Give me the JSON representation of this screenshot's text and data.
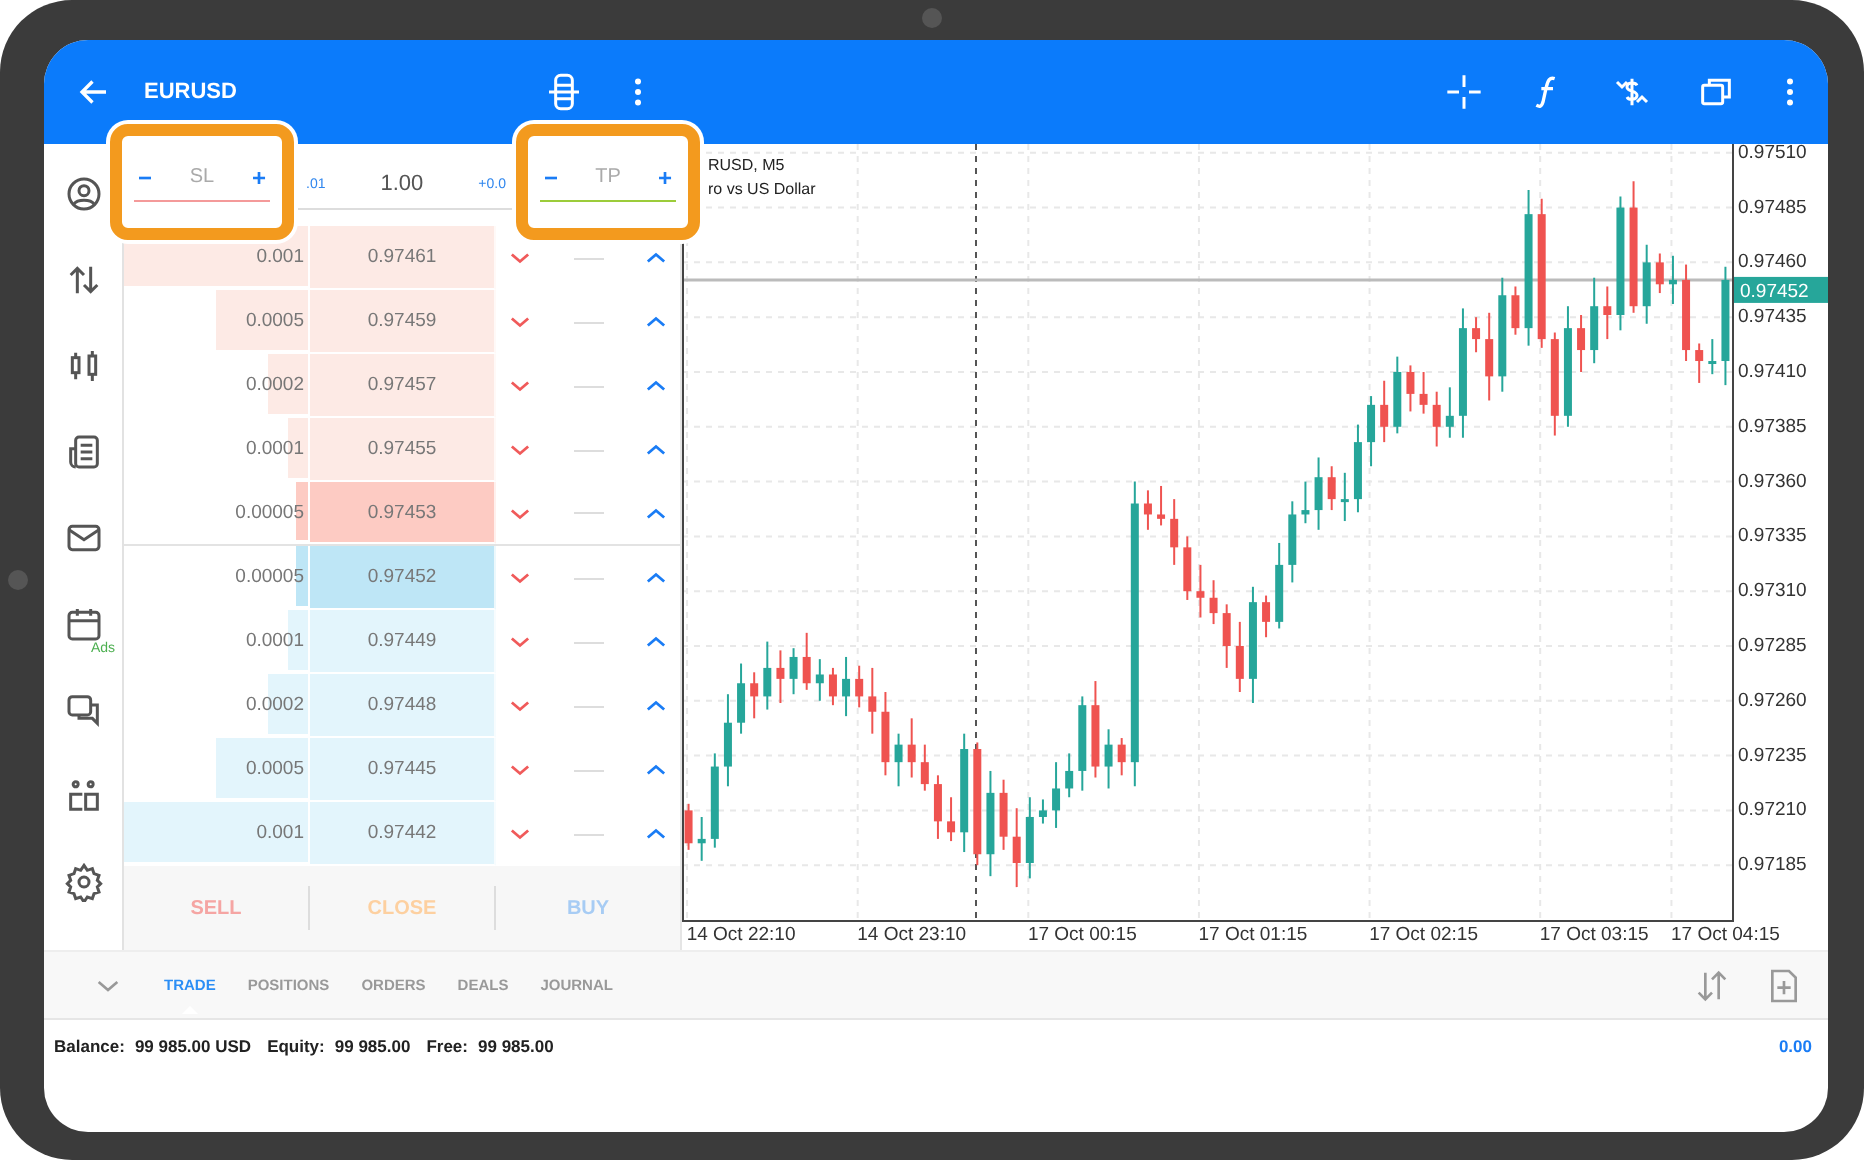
{
  "top_bar": {
    "title": "EURUSD"
  },
  "side_nav": {
    "ads_badge": "Ads"
  },
  "order_panel": {
    "sl_field": {
      "minus": "−",
      "label": "SL",
      "plus": "+",
      "kind": "sl",
      "highlighted": true
    },
    "volume": {
      "step_down": ".01",
      "value": "1.00",
      "step_up": "+0.0"
    },
    "tp_field": {
      "minus": "−",
      "label": "TP",
      "plus": "+",
      "kind": "tp",
      "highlighted": true
    },
    "depth_rows": [
      {
        "volume": "0.001",
        "price": "0.97461",
        "kind": "sell",
        "best": false,
        "level": 1
      },
      {
        "volume": "0.0005",
        "price": "0.97459",
        "kind": "sell",
        "best": false,
        "level": 0.5
      },
      {
        "volume": "0.0002",
        "price": "0.97457",
        "kind": "sell",
        "best": false,
        "level": 0.22
      },
      {
        "volume": "0.0001",
        "price": "0.97455",
        "kind": "sell",
        "best": false,
        "level": 0.11
      },
      {
        "volume": "0.00005",
        "price": "0.97453",
        "kind": "sell",
        "best": true,
        "level": 0.06
      },
      {
        "volume": "0.00005",
        "price": "0.97452",
        "kind": "buy",
        "best": true,
        "level": 0.06
      },
      {
        "volume": "0.0001",
        "price": "0.97449",
        "kind": "buy",
        "best": false,
        "level": 0.11
      },
      {
        "volume": "0.0002",
        "price": "0.97448",
        "kind": "buy",
        "best": false,
        "level": 0.22
      },
      {
        "volume": "0.0005",
        "price": "0.97445",
        "kind": "buy",
        "best": false,
        "level": 0.5
      },
      {
        "volume": "0.001",
        "price": "0.97442",
        "kind": "buy",
        "best": false,
        "level": 1
      }
    ],
    "buttons": [
      {
        "label": "SELL",
        "kind": "sell",
        "disabled": true
      },
      {
        "label": "CLOSE",
        "kind": "close",
        "disabled": true
      },
      {
        "label": "BUY",
        "kind": "buy",
        "disabled": true
      }
    ]
  },
  "chart": {
    "symbol": "RUSD, M5",
    "description": "ro vs US Dollar",
    "chart_data": {
      "type": "candlestick",
      "categories": [
        null,
        null,
        null,
        null,
        "14 Oct 22:10",
        null,
        null,
        null,
        null,
        null,
        null,
        null,
        null,
        null,
        null,
        null,
        null,
        "14 Oct 23:10",
        null,
        null,
        null,
        null,
        null,
        null,
        null,
        null,
        null,
        null,
        null,
        null,
        "17 Oct 00:15",
        null,
        null,
        null,
        null,
        null,
        null,
        null,
        null,
        null,
        null,
        null,
        null,
        "17 Oct 01:15",
        null,
        null,
        null,
        null,
        null,
        null,
        null,
        null,
        null,
        null,
        null,
        null,
        "17 Oct 02:15",
        null,
        null,
        null,
        null,
        null,
        null,
        null,
        null,
        null,
        null,
        null,
        null,
        "17 Oct 03:15",
        null,
        null,
        null,
        null,
        null,
        null,
        null,
        null,
        null,
        "17 Oct 04:15"
      ],
      "grid": true,
      "ref_lines": [
        {
          "axis": "y",
          "value": 0.97452,
          "label": "0.97452"
        }
      ],
      "ohlc": [
        [
          0.9721,
          0.97213,
          0.97192,
          0.97195
        ],
        [
          0.97195,
          0.97207,
          0.97187,
          0.97197
        ],
        [
          0.97197,
          0.97236,
          0.97193,
          0.9723
        ],
        [
          0.9723,
          0.97263,
          0.97221,
          0.9725
        ],
        [
          0.9725,
          0.97277,
          0.97245,
          0.97268
        ],
        [
          0.97268,
          0.97273,
          0.97252,
          0.97262
        ],
        [
          0.97262,
          0.97287,
          0.97256,
          0.97275
        ],
        [
          0.97275,
          0.97283,
          0.97259,
          0.9727
        ],
        [
          0.9727,
          0.97284,
          0.97263,
          0.9728
        ],
        [
          0.9728,
          0.97291,
          0.97265,
          0.97268
        ],
        [
          0.97268,
          0.97279,
          0.9726,
          0.97272
        ],
        [
          0.97272,
          0.97275,
          0.97258,
          0.97262
        ],
        [
          0.97262,
          0.9728,
          0.97253,
          0.9727
        ],
        [
          0.9727,
          0.97276,
          0.97257,
          0.97262
        ],
        [
          0.97262,
          0.97275,
          0.97245,
          0.97255
        ],
        [
          0.97255,
          0.97264,
          0.97226,
          0.97232
        ],
        [
          0.97232,
          0.97245,
          0.97221,
          0.9724
        ],
        [
          0.9724,
          0.97252,
          0.97225,
          0.97232
        ],
        [
          0.97232,
          0.9724,
          0.97219,
          0.97222
        ],
        [
          0.97222,
          0.97226,
          0.97197,
          0.97205
        ],
        [
          0.97205,
          0.97216,
          0.97196,
          0.972
        ],
        [
          0.972,
          0.97245,
          0.97191,
          0.97238
        ],
        [
          0.97238,
          0.97241,
          0.97185,
          0.9719
        ],
        [
          0.9719,
          0.97228,
          0.9718,
          0.97218
        ],
        [
          0.97218,
          0.97224,
          0.97192,
          0.97198
        ],
        [
          0.97198,
          0.97211,
          0.97175,
          0.97186
        ],
        [
          0.97186,
          0.97216,
          0.97179,
          0.97207
        ],
        [
          0.97207,
          0.97215,
          0.97204,
          0.9721
        ],
        [
          0.9721,
          0.97232,
          0.97202,
          0.9722
        ],
        [
          0.9722,
          0.97236,
          0.97216,
          0.97228
        ],
        [
          0.97228,
          0.97262,
          0.97219,
          0.97258
        ],
        [
          0.97258,
          0.97269,
          0.97225,
          0.9723
        ],
        [
          0.9723,
          0.97247,
          0.9722,
          0.9724
        ],
        [
          0.9724,
          0.97243,
          0.97226,
          0.97232
        ],
        [
          0.97232,
          0.9736,
          0.97221,
          0.9735
        ],
        [
          0.9735,
          0.97356,
          0.97338,
          0.97345
        ],
        [
          0.97345,
          0.97358,
          0.9734,
          0.97343
        ],
        [
          0.97343,
          0.97352,
          0.97322,
          0.9733
        ],
        [
          0.9733,
          0.97335,
          0.97306,
          0.9731
        ],
        [
          0.9731,
          0.97322,
          0.97298,
          0.97307
        ],
        [
          0.97307,
          0.97315,
          0.97295,
          0.973
        ],
        [
          0.973,
          0.97304,
          0.97275,
          0.97285
        ],
        [
          0.97285,
          0.97296,
          0.97264,
          0.9727
        ],
        [
          0.9727,
          0.97312,
          0.97259,
          0.97305
        ],
        [
          0.97305,
          0.97308,
          0.97289,
          0.97296
        ],
        [
          0.97296,
          0.97332,
          0.97293,
          0.97322
        ],
        [
          0.97322,
          0.97351,
          0.97314,
          0.97345
        ],
        [
          0.97345,
          0.9736,
          0.97341,
          0.97347
        ],
        [
          0.97347,
          0.97371,
          0.97338,
          0.97362
        ],
        [
          0.97362,
          0.97367,
          0.97347,
          0.97352
        ],
        [
          0.97352,
          0.97364,
          0.97342,
          0.97352
        ],
        [
          0.97352,
          0.97386,
          0.97346,
          0.97378
        ],
        [
          0.97378,
          0.97399,
          0.97367,
          0.97395
        ],
        [
          0.97395,
          0.97406,
          0.97378,
          0.97385
        ],
        [
          0.97385,
          0.97417,
          0.97382,
          0.9741
        ],
        [
          0.9741,
          0.97413,
          0.97392,
          0.974
        ],
        [
          0.974,
          0.9741,
          0.97391,
          0.97395
        ],
        [
          0.97395,
          0.97401,
          0.97376,
          0.97385
        ],
        [
          0.97385,
          0.97403,
          0.9738,
          0.9739
        ],
        [
          0.9739,
          0.97439,
          0.9738,
          0.9743
        ],
        [
          0.9743,
          0.97435,
          0.97419,
          0.97425
        ],
        [
          0.97425,
          0.97437,
          0.97397,
          0.97408
        ],
        [
          0.97408,
          0.97453,
          0.97401,
          0.97445
        ],
        [
          0.97445,
          0.97449,
          0.97427,
          0.9743
        ],
        [
          0.9743,
          0.97493,
          0.97422,
          0.97482
        ],
        [
          0.97482,
          0.97489,
          0.97421,
          0.97425
        ],
        [
          0.97425,
          0.97428,
          0.97381,
          0.9739
        ],
        [
          0.9739,
          0.9744,
          0.97385,
          0.9743
        ],
        [
          0.9743,
          0.97436,
          0.9741,
          0.9742
        ],
        [
          0.9742,
          0.97453,
          0.97414,
          0.9744
        ],
        [
          0.9744,
          0.97449,
          0.97425,
          0.97436
        ],
        [
          0.97436,
          0.9749,
          0.97429,
          0.97485
        ],
        [
          0.97485,
          0.97497,
          0.97437,
          0.9744
        ],
        [
          0.9744,
          0.97468,
          0.97432,
          0.9746
        ],
        [
          0.9746,
          0.97464,
          0.97446,
          0.9745
        ],
        [
          0.9745,
          0.97463,
          0.97441,
          0.97452
        ],
        [
          0.97452,
          0.97459,
          0.97415,
          0.9742
        ],
        [
          0.9742,
          0.97423,
          0.97405,
          0.97415
        ],
        [
          0.97415,
          0.97425,
          0.97409,
          0.97415
        ],
        [
          0.97415,
          0.97458,
          0.97404,
          0.97452
        ]
      ],
      "ylim": [
        0.9716,
        0.97514
      ],
      "yticks": [
        {
          "value": 0.9751,
          "label": "0.97510"
        },
        {
          "value": 0.97485,
          "label": "0.97485"
        },
        {
          "value": 0.9746,
          "label": "0.97460"
        },
        {
          "value": 0.97435,
          "label": "0.97435"
        },
        {
          "value": 0.9741,
          "label": "0.97410"
        },
        {
          "value": 0.97385,
          "label": "0.97385"
        },
        {
          "value": 0.9736,
          "label": "0.97360"
        },
        {
          "value": 0.97335,
          "label": "0.97335"
        },
        {
          "value": 0.9731,
          "label": "0.97310"
        },
        {
          "value": 0.97285,
          "label": "0.97285"
        },
        {
          "value": 0.9726,
          "label": "0.97260"
        },
        {
          "value": 0.97235,
          "label": "0.97235"
        },
        {
          "value": 0.9721,
          "label": "0.97210"
        },
        {
          "value": 0.97185,
          "label": "0.97185"
        }
      ]
    }
  },
  "bottom_panel": {
    "tabs": [
      {
        "label": "TRADE",
        "selected": true
      },
      {
        "label": "POSITIONS",
        "selected": false
      },
      {
        "label": "ORDERS",
        "selected": false
      },
      {
        "label": "DEALS",
        "selected": false
      },
      {
        "label": "JOURNAL",
        "selected": false
      }
    ],
    "account": [
      {
        "label": "Balance:",
        "value": "99 985.00 USD"
      },
      {
        "label": "Equity:",
        "value": "99 985.00"
      },
      {
        "label": "Free:",
        "value": "99 985.00"
      }
    ],
    "profit": "0.00"
  }
}
